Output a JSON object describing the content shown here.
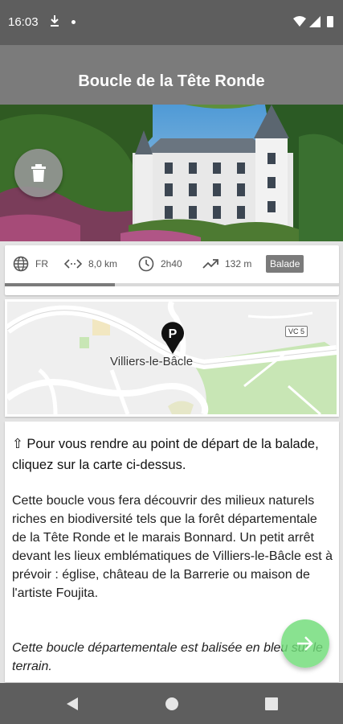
{
  "status_bar": {
    "time": "16:03",
    "icons": [
      "download-icon",
      "dot-icon",
      "wifi-icon",
      "signal-icon",
      "battery-icon"
    ]
  },
  "app_bar": {
    "title": "Boucle de la Tête Ronde"
  },
  "hero": {
    "delete_icon": "trash-icon"
  },
  "info": {
    "language": "FR",
    "distance": "8,0 km",
    "duration": "2h40",
    "elevation": "132 m",
    "type_badge": "Balade",
    "progress": 0.33
  },
  "map": {
    "town_label": "Villiers-le-Bâcle",
    "road_label": "VC 5",
    "pin_letter": "P"
  },
  "description": {
    "instruction": "⇧ Pour vous rendre au point de départ de la balade, cliquez sur la carte ci-dessus.",
    "body": "Cette boucle vous fera découvrir des milieux naturels riches en biodiversité tels que la forêt départementale de la Tête Ronde et le marais Bonnard. Un petit arrêt devant les lieux emblématiques de Villiers-le-Bâcle est à prévoir : église, château de la Barrerie ou maison de l'artiste Foujita.",
    "note": "Cette boucle départementale est balisée en bleu sur le terrain."
  },
  "fab": {
    "next_icon": "arrow-right-icon"
  },
  "colors": {
    "status_bar": "#5e5e5e",
    "app_bar": "#7b7b7b",
    "fab_green": "#6fdc78",
    "background": "#e3e3e3"
  }
}
